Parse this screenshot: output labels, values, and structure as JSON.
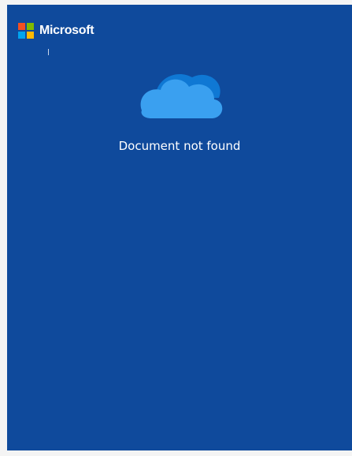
{
  "brand": {
    "name": "Microsoft",
    "logo_colors": [
      "#f25022",
      "#7fba00",
      "#00a4ef",
      "#ffb900"
    ]
  },
  "main": {
    "icon": "onedrive-cloud-icon",
    "message": "Document not found"
  },
  "colors": {
    "background": "#0f4a9c",
    "cloud_dark": "#0f78d4",
    "cloud_light": "#3aa0f0",
    "text": "#ffffff"
  }
}
